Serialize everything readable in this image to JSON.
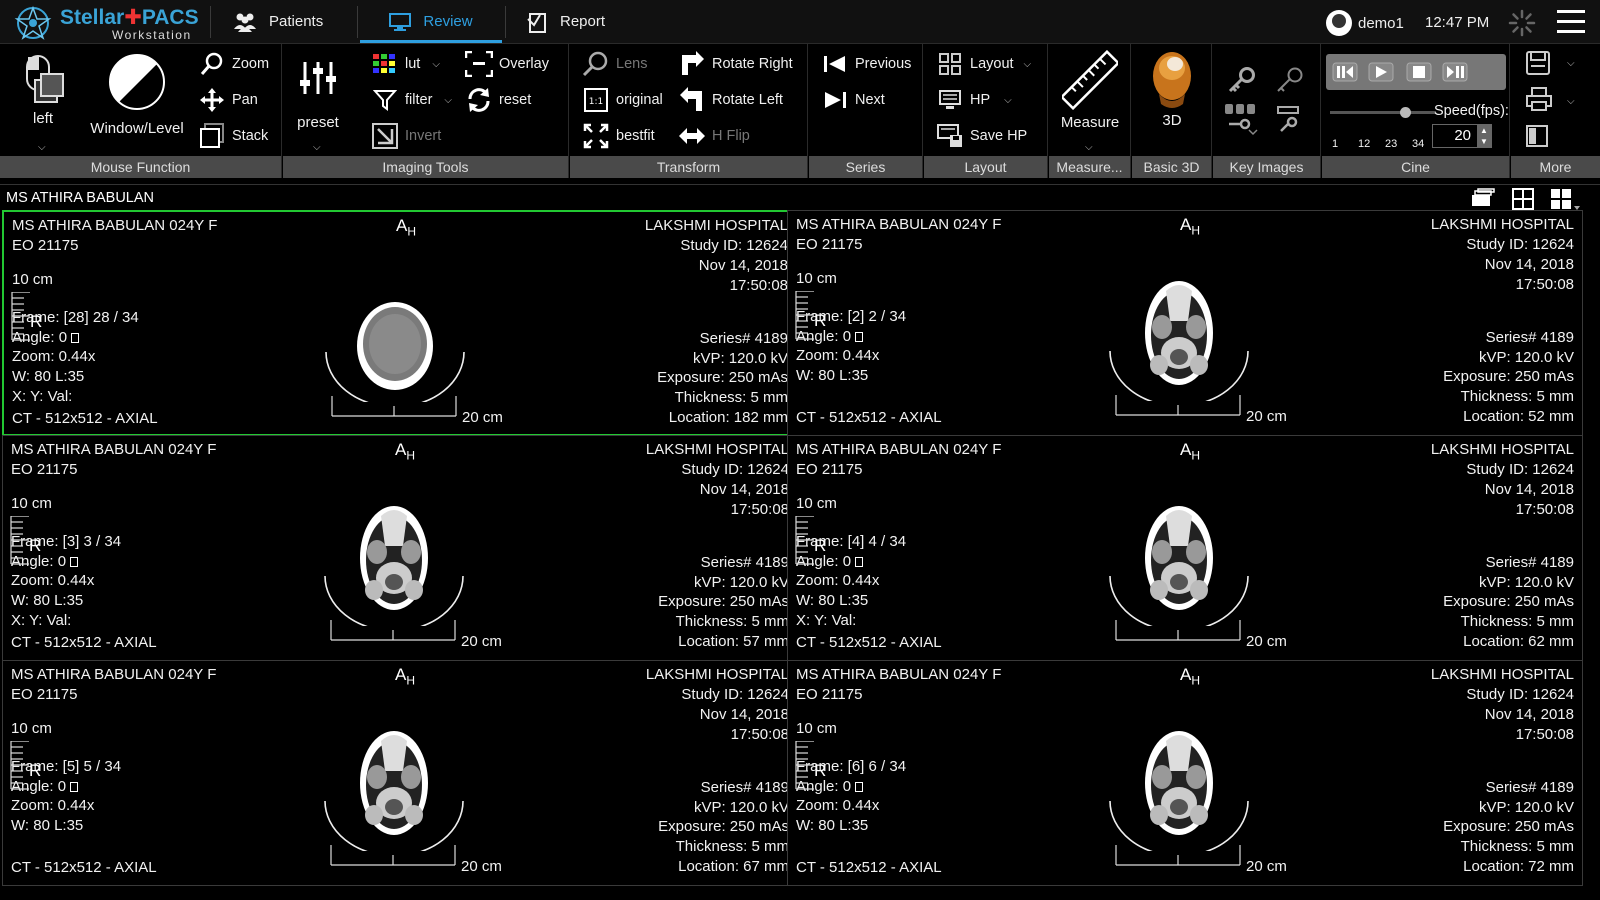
{
  "app": {
    "logo_main": "Stellar",
    "logo_accent": "PACS",
    "logo_sub": "Workstation"
  },
  "nav": {
    "tabs": [
      {
        "label": "Patients",
        "icon": "patients-icon"
      },
      {
        "label": "Review",
        "icon": "monitor-icon",
        "active": true
      },
      {
        "label": "Report",
        "icon": "report-icon"
      }
    ],
    "user": "demo1",
    "time": "12:47 PM"
  },
  "ribbon": {
    "mouse": {
      "group_label": "Mouse Function",
      "left": "left",
      "window_level": "Window/Level",
      "zoom": "Zoom",
      "pan": "Pan",
      "stack": "Stack"
    },
    "imaging": {
      "group_label": "Imaging Tools",
      "preset": "preset",
      "lut": "lut",
      "filter": "filter",
      "invert": "Invert",
      "overlay": "Overlay",
      "reset": "reset"
    },
    "transform": {
      "group_label": "Transform",
      "lens": "Lens",
      "original": "original",
      "bestfit": "bestfit",
      "rotate_right": "Rotate Right",
      "rotate_left": "Rotate Left",
      "hflip": "H Flip"
    },
    "series": {
      "group_label": "Series",
      "previous": "Previous",
      "next": "Next"
    },
    "layout": {
      "group_label": "Layout",
      "layout": "Layout",
      "hp": "HP",
      "save_hp": "Save HP"
    },
    "measure": {
      "group_label": "Measure...",
      "measure": "Measure"
    },
    "basic3d": {
      "group_label": "Basic 3D",
      "label": "3D"
    },
    "key_images": {
      "group_label": "Key Images"
    },
    "cine": {
      "group_label": "Cine",
      "speed_label": "Speed(fps):",
      "speed_value": "20",
      "ticks": [
        "1",
        "12",
        "23",
        "34"
      ]
    },
    "more": {
      "group_label": "More"
    }
  },
  "study": {
    "patient_name": "MS ATHIRA BABULAN"
  },
  "viewports": [
    {
      "patient": "MS ATHIRA BABULAN 024Y F",
      "eo": "EO 21175",
      "hospital": "LAKSHMI HOSPITAL",
      "study_id": "Study ID: 12624",
      "date": "Nov 14, 2018",
      "time": "17:50:08",
      "scale": "10 cm",
      "frame": "Frame: [28] 28 / 34",
      "angle": "Angle: 0",
      "zoom": "Zoom: 0.44x",
      "wl": "W: 80 L:35",
      "xy": "X:  Y:   Val:",
      "series": "Series# 4189",
      "kvp": "kVP: 120.0 kV",
      "exposure": "Exposure: 250 mAs",
      "thickness": "Thickness: 5 mm",
      "location": "Location: 182 mm",
      "modality": "CT - 512x512 - AXIAL",
      "hscale": "20 cm",
      "orient": "A",
      "orient_sub": "H"
    },
    {
      "patient": "MS ATHIRA BABULAN 024Y F",
      "eo": "EO 21175",
      "hospital": "LAKSHMI HOSPITAL",
      "study_id": "Study ID: 12624",
      "date": "Nov 14, 2018",
      "time": "17:50:08",
      "scale": "10 cm",
      "frame": "Frame: [2] 2 / 34",
      "angle": "Angle: 0",
      "zoom": "Zoom: 0.44x",
      "wl": "W: 80 L:35",
      "xy": "",
      "series": "Series# 4189",
      "kvp": "kVP: 120.0 kV",
      "exposure": "Exposure: 250 mAs",
      "thickness": "Thickness: 5 mm",
      "location": "Location: 52 mm",
      "modality": "CT - 512x512 - AXIAL",
      "hscale": "20 cm",
      "orient": "A",
      "orient_sub": "H"
    },
    {
      "patient": "MS ATHIRA BABULAN 024Y F",
      "eo": "EO 21175",
      "hospital": "LAKSHMI HOSPITAL",
      "study_id": "Study ID: 12624",
      "date": "Nov 14, 2018",
      "time": "17:50:08",
      "scale": "10 cm",
      "frame": "Frame: [3] 3 / 34",
      "angle": "Angle: 0",
      "zoom": "Zoom: 0.44x",
      "wl": "W: 80 L:35",
      "xy": "X:  Y:   Val:",
      "series": "Series# 4189",
      "kvp": "kVP: 120.0 kV",
      "exposure": "Exposure: 250 mAs",
      "thickness": "Thickness: 5 mm",
      "location": "Location: 57 mm",
      "modality": "CT - 512x512 - AXIAL",
      "hscale": "20 cm",
      "orient": "A",
      "orient_sub": "H"
    },
    {
      "patient": "MS ATHIRA BABULAN 024Y F",
      "eo": "EO 21175",
      "hospital": "LAKSHMI HOSPITAL",
      "study_id": "Study ID: 12624",
      "date": "Nov 14, 2018",
      "time": "17:50:08",
      "scale": "10 cm",
      "frame": "Frame: [4] 4 / 34",
      "angle": "Angle: 0",
      "zoom": "Zoom: 0.44x",
      "wl": "W: 80 L:35",
      "xy": "X:  Y:   Val:",
      "series": "Series# 4189",
      "kvp": "kVP: 120.0 kV",
      "exposure": "Exposure: 250 mAs",
      "thickness": "Thickness: 5 mm",
      "location": "Location: 62 mm",
      "modality": "CT - 512x512 - AXIAL",
      "hscale": "20 cm",
      "orient": "A",
      "orient_sub": "H"
    },
    {
      "patient": "MS ATHIRA BABULAN 024Y F",
      "eo": "EO 21175",
      "hospital": "LAKSHMI HOSPITAL",
      "study_id": "Study ID: 12624",
      "date": "Nov 14, 2018",
      "time": "17:50:08",
      "scale": "10 cm",
      "frame": "Frame: [5] 5 / 34",
      "angle": "Angle: 0",
      "zoom": "Zoom: 0.44x",
      "wl": "W: 80 L:35",
      "xy": "",
      "series": "Series# 4189",
      "kvp": "kVP: 120.0 kV",
      "exposure": "Exposure: 250 mAs",
      "thickness": "Thickness: 5 mm",
      "location": "Location: 67 mm",
      "modality": "CT - 512x512 - AXIAL",
      "hscale": "20 cm",
      "orient": "A",
      "orient_sub": "H"
    },
    {
      "patient": "MS ATHIRA BABULAN 024Y F",
      "eo": "EO 21175",
      "hospital": "LAKSHMI HOSPITAL",
      "study_id": "Study ID: 12624",
      "date": "Nov 14, 2018",
      "time": "17:50:08",
      "scale": "10 cm",
      "frame": "Frame: [6] 6 / 34",
      "angle": "Angle: 0",
      "zoom": "Zoom: 0.44x",
      "wl": "W: 80 L:35",
      "xy": "",
      "series": "Series# 4189",
      "kvp": "kVP: 120.0 kV",
      "exposure": "Exposure: 250 mAs",
      "thickness": "Thickness: 5 mm",
      "location": "Location: 72 mm",
      "modality": "CT - 512x512 - AXIAL",
      "hscale": "20 cm",
      "orient": "A",
      "orient_sub": "H"
    }
  ],
  "colors": {
    "accent": "#2e9fe0",
    "active_viewport": "#22c832",
    "ribbon_label_bg": "#4a4a4a"
  }
}
